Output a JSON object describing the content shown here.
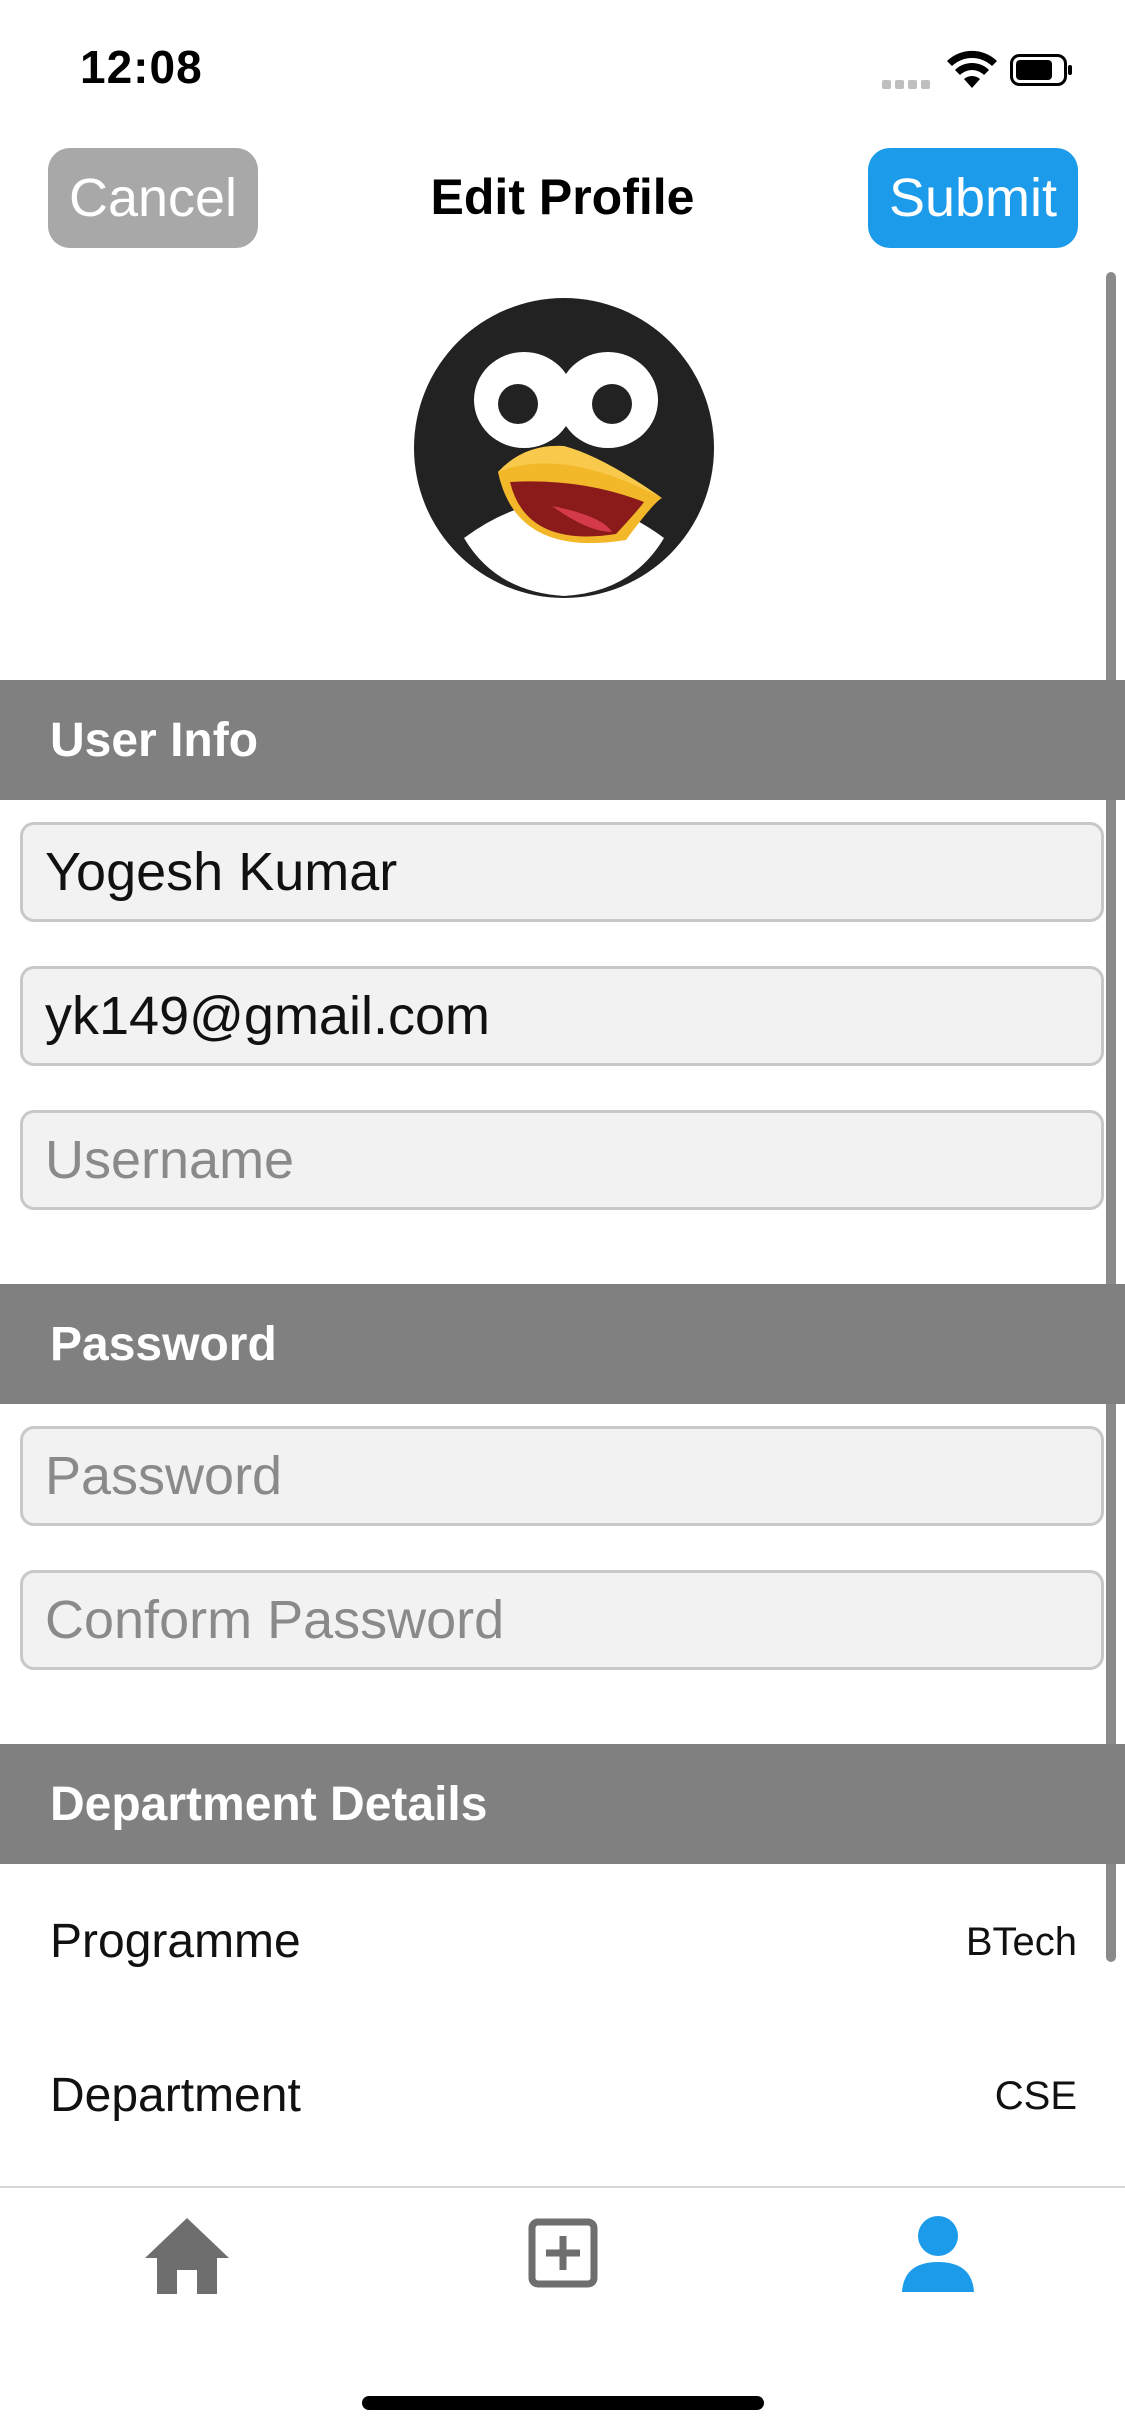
{
  "status_bar": {
    "time": "12:08"
  },
  "nav": {
    "cancel_label": "Cancel",
    "title": "Edit Profile",
    "submit_label": "Submit"
  },
  "colors": {
    "accent": "#1c9bea",
    "section_header": "#808080",
    "cancel": "#a8a8a8"
  },
  "sections": {
    "user_info": {
      "header": "User Info",
      "name_value": "Yogesh Kumar",
      "email_value": "yk149@gmail.com",
      "username_placeholder": "Username"
    },
    "password": {
      "header": "Password",
      "password_placeholder": "Password",
      "confirm_placeholder": "Conform Password"
    },
    "department": {
      "header": "Department Details",
      "rows": [
        {
          "label": "Programme",
          "value": "BTech"
        },
        {
          "label": "Department",
          "value": "CSE"
        }
      ]
    }
  },
  "tabbar": {
    "icons": [
      "home-icon",
      "add-square-icon",
      "profile-icon"
    ],
    "active": "profile-icon"
  }
}
